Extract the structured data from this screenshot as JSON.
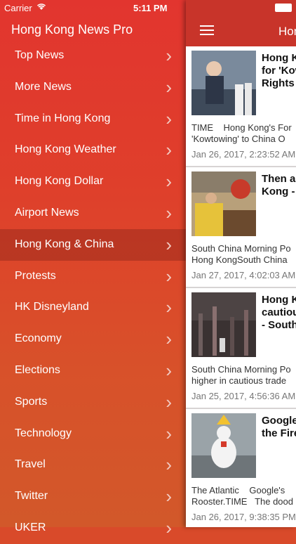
{
  "status": {
    "carrier": "Carrier",
    "time": "5:11 PM"
  },
  "drawer": {
    "title": "Hong Kong News Pro",
    "items": [
      {
        "label": "Top News"
      },
      {
        "label": "More News"
      },
      {
        "label": "Time in Hong Kong"
      },
      {
        "label": "Hong Kong Weather"
      },
      {
        "label": "Hong Kong Dollar"
      },
      {
        "label": "Airport News"
      },
      {
        "label": "Hong Kong & China",
        "active": true
      },
      {
        "label": "Protests"
      },
      {
        "label": "HK Disneyland"
      },
      {
        "label": "Economy"
      },
      {
        "label": "Elections"
      },
      {
        "label": "Sports"
      },
      {
        "label": "Technology"
      },
      {
        "label": "Travel"
      },
      {
        "label": "Twitter"
      },
      {
        "label": "UKER"
      }
    ]
  },
  "header": {
    "title": "Hong Kong & China"
  },
  "articles": [
    {
      "title": "Hong Kong's\nfor 'Kowt\nRights",
      "source": "TIME    Hong Kong's For\n'Kowtowing' to China O",
      "date": "Jan 26, 2017, 2:23:52 AM"
    },
    {
      "title": "Then a\nKong -",
      "source": "South China Morning Po\nHong KongSouth China",
      "date": "Jan 27, 2017, 4:02:03 AM"
    },
    {
      "title": "Hong K\ncautiou\n- South",
      "source": "South China Morning Po\nhigher in cautious trade",
      "date": "Jan 25, 2017, 4:56:36 AM"
    },
    {
      "title": "Google\nthe Fire",
      "source": "The Atlantic    Google's\nRooster.TIME   The dood",
      "date": "Jan 26, 2017, 9:38:35 PM"
    }
  ],
  "icons": {
    "chevron": "chevron-right-icon",
    "menu": "hamburger-menu-icon"
  },
  "colors": {
    "drawer_top": "#e2352f",
    "drawer_bottom": "#d2582a",
    "navbar": "#c8342a"
  }
}
